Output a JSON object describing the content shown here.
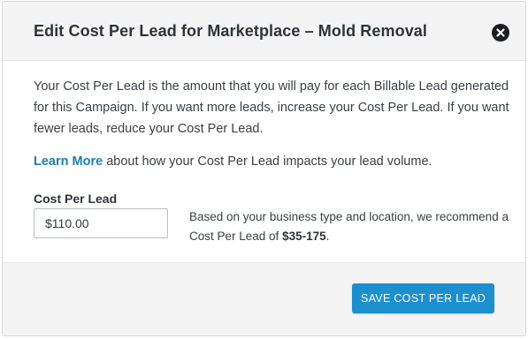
{
  "modal": {
    "title": "Edit Cost Per Lead for Marketplace – Mold Removal",
    "close_icon": "close-icon"
  },
  "content": {
    "description": "Your Cost Per Lead is the amount that you will pay for each Billable Lead generated for this Campaign. If you want more leads, increase your Cost Per Lead. If you want fewer leads, reduce your Cost Per Lead.",
    "learn_more_link": "Learn More",
    "learn_more_suffix": " about how your Cost Per Lead impacts your lead volume.",
    "cpl_label": "Cost Per Lead",
    "cpl_value": "$110.00",
    "recommend_prefix": "Based on your business type and location, we recommend a Cost Per Lead of ",
    "recommend_range": "$35-175",
    "recommend_suffix": "."
  },
  "footer": {
    "save_label": "SAVE COST PER LEAD"
  },
  "colors": {
    "accent": "#1c8fcf",
    "link": "#1a7fb5",
    "header_bg": "#f4f4f5"
  }
}
